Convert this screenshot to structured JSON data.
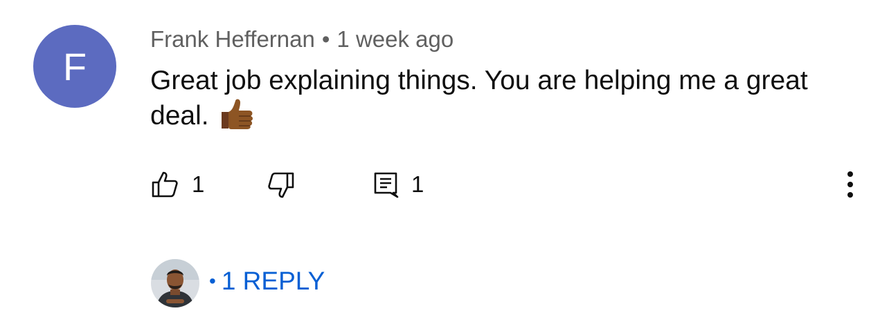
{
  "comment": {
    "avatar_letter": "F",
    "avatar_color": "#5c6bc0",
    "author": "Frank Heffernan",
    "separator": "•",
    "time": "1 week ago",
    "text": "Great job explaining things. You are helping me a great deal.",
    "emoji_icon": "thumbs-up-emoji-medium-dark-skin"
  },
  "actions": {
    "like_count": "1",
    "reply_count": "1",
    "icons": [
      "like-icon",
      "dislike-icon",
      "reply-icon",
      "more-options-icon"
    ]
  },
  "replies": {
    "separator": "•",
    "label": "1 REPLY",
    "link_color": "#065fd4"
  }
}
